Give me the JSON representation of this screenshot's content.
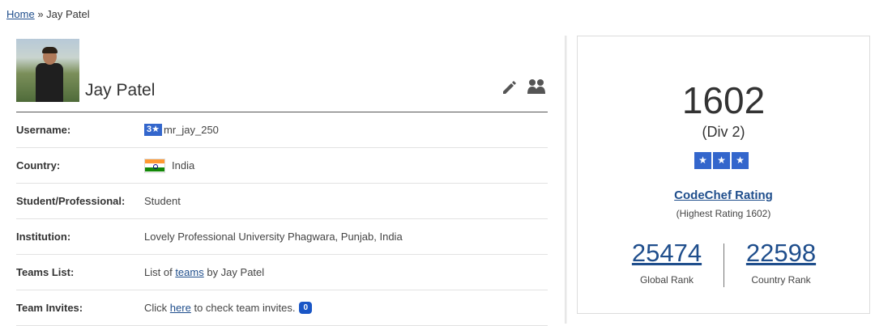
{
  "breadcrumb": {
    "home_label": "Home",
    "separator": "»",
    "current": "Jay Patel"
  },
  "profile": {
    "name": "Jay Patel",
    "avatar_icon": "user-photo",
    "edit_icon": "pencil-icon",
    "friends_icon": "friends-icon"
  },
  "details": {
    "username": {
      "label": "Username:",
      "star_badge": "3★",
      "value": "mr_jay_250"
    },
    "country": {
      "label": "Country:",
      "value": "India"
    },
    "occupation": {
      "label": "Student/Professional:",
      "value": "Student"
    },
    "institution": {
      "label": "Institution:",
      "value": "Lovely Professional University Phagwara, Punjab, India"
    },
    "teams": {
      "label": "Teams List:",
      "prefix": "List of",
      "link": "teams",
      "suffix": "by Jay Patel"
    },
    "invites": {
      "label": "Team Invites:",
      "prefix": "Click",
      "link": "here",
      "suffix": "to check team invites.",
      "count": "0"
    }
  },
  "rating": {
    "value": "1602",
    "division": "(Div 2)",
    "stars": [
      "★",
      "★",
      "★"
    ],
    "link_label": "CodeChef Rating",
    "highest": "(Highest Rating 1602)",
    "global_rank": "25474",
    "global_rank_label": "Global Rank",
    "country_rank": "22598",
    "country_rank_label": "Country Rank"
  },
  "colors": {
    "link": "#1f4e8c",
    "star_blue": "#3366cc",
    "badge_blue": "#1a56c6"
  }
}
